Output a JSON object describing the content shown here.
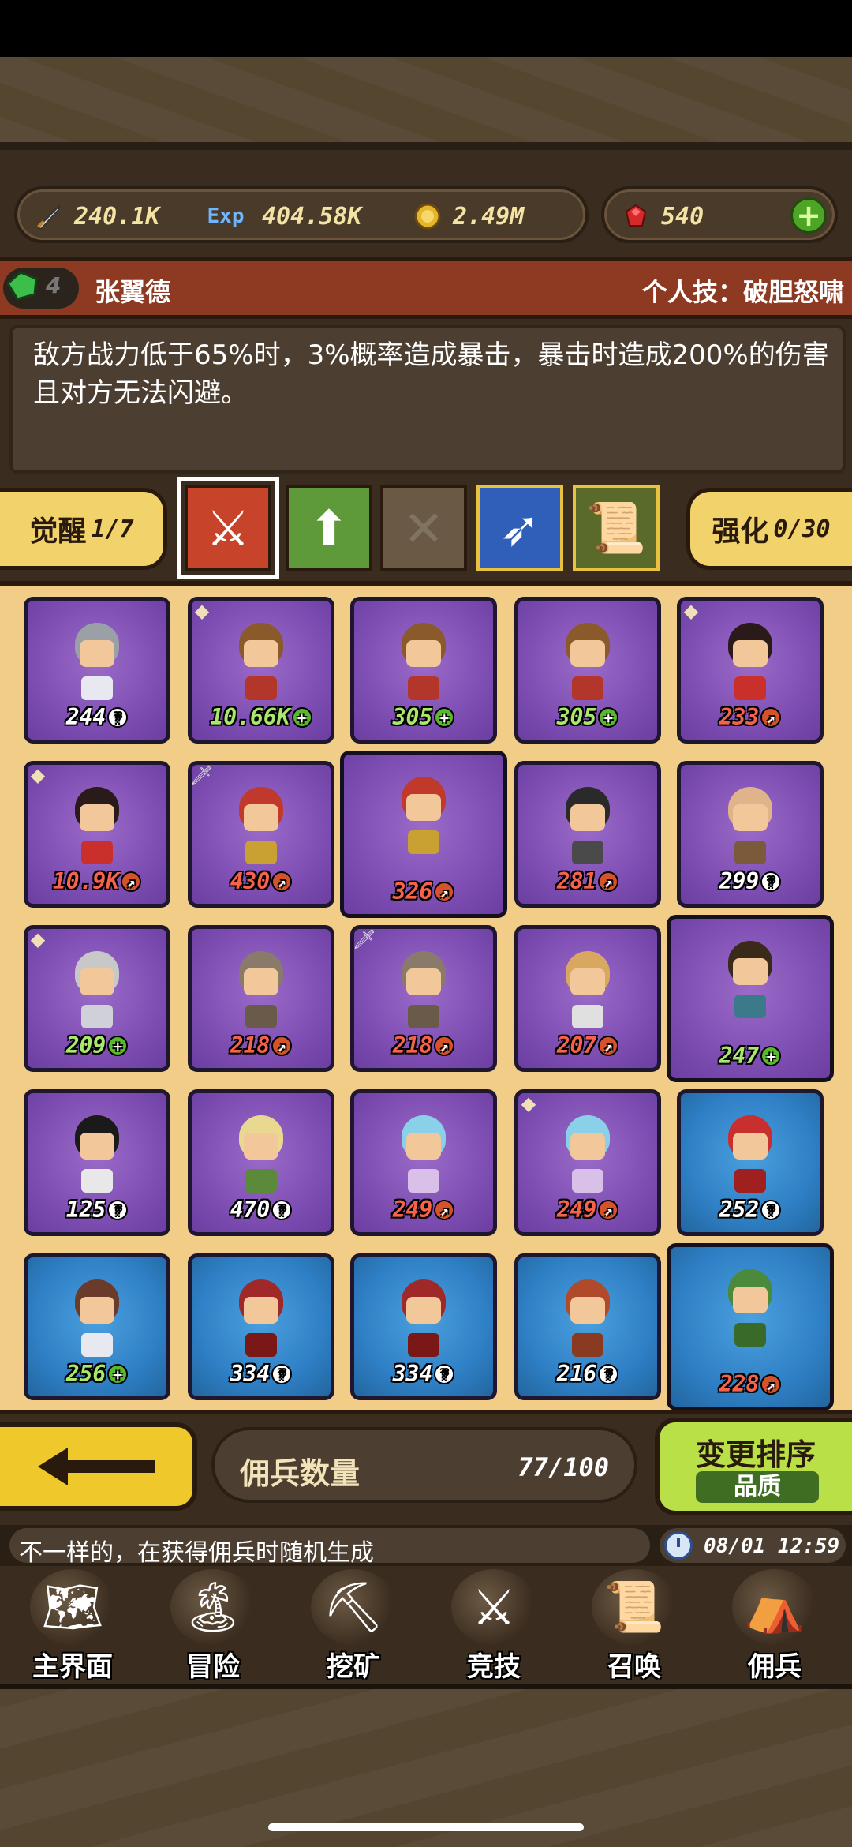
{
  "resources": {
    "attack": {
      "icon": "sword-icon",
      "value": "240.1K"
    },
    "exp": {
      "icon": "exp-icon",
      "label": "Exp",
      "value": "404.58K"
    },
    "gold": {
      "icon": "coin-icon",
      "value": "2.49M"
    },
    "gem": {
      "icon": "ruby-icon",
      "value": "540"
    },
    "add": "+"
  },
  "hero": {
    "gem_level": "4",
    "name": "张翼德",
    "skill": "个人技：破胆怒啸",
    "description": "敌方战力低于65%时，3%概率造成暴击，暴击时造成200%的伤害且对方无法闪避。"
  },
  "tabs": {
    "awaken_label": "觉醒",
    "awaken_value": "1/7",
    "enhance_label": "强化",
    "enhance_value": "0/30"
  },
  "skills": [
    {
      "icon": "crossed-blades-icon",
      "glyph": "⚔"
    },
    {
      "icon": "up-deal-icon",
      "glyph": "⬆"
    },
    {
      "icon": "empty-slot-icon",
      "glyph": "✕"
    },
    {
      "icon": "spear-icon",
      "glyph": "➶"
    },
    {
      "icon": "scroll-icon",
      "glyph": "📜"
    }
  ],
  "mercenaries": [
    {
      "level": "244",
      "badge": "?",
      "color": "white",
      "bg": "purple",
      "tag": "",
      "hair": "#9aa0a6",
      "cloth": "#e8e8f0"
    },
    {
      "level": "10.66K",
      "badge": "+",
      "color": "green",
      "bg": "purple",
      "tag": "leaf",
      "hair": "#8a5a2b",
      "cloth": "#b3362b"
    },
    {
      "level": "305",
      "badge": "+",
      "color": "green",
      "bg": "purple",
      "tag": "",
      "hair": "#8a5a2b",
      "cloth": "#b3362b"
    },
    {
      "level": "305",
      "badge": "+",
      "color": "green",
      "bg": "purple",
      "tag": "",
      "hair": "#8a5a2b",
      "cloth": "#b3362b"
    },
    {
      "level": "233",
      "badge": "↗",
      "color": "red",
      "bg": "purple",
      "tag": "leaf",
      "hair": "#2a1a1a",
      "cloth": "#c9302c"
    },
    {
      "level": "10.9K",
      "badge": "↗",
      "color": "red",
      "bg": "purple",
      "tag": "leaf",
      "hair": "#2a1a1a",
      "cloth": "#c9302c"
    },
    {
      "level": "430",
      "badge": "↗",
      "color": "red",
      "bg": "purple",
      "tag": "sword",
      "hair": "#c0392b",
      "cloth": "#c9a032"
    },
    {
      "level": "326",
      "badge": "↗",
      "color": "red",
      "bg": "purple",
      "tag": "",
      "hair": "#c0392b",
      "cloth": "#c9a032",
      "big": true
    },
    {
      "level": "281",
      "badge": "↗",
      "color": "red",
      "bg": "purple",
      "tag": "",
      "hair": "#2a2a2a",
      "cloth": "#4a4a4a"
    },
    {
      "level": "299",
      "badge": "?",
      "color": "white",
      "bg": "purple",
      "tag": "",
      "hair": "#e0b48a",
      "cloth": "#7a5a3a"
    },
    {
      "level": "209",
      "badge": "+",
      "color": "green",
      "bg": "purple",
      "tag": "leaf",
      "hair": "#c8c8c8",
      "cloth": "#d0d0d8"
    },
    {
      "level": "218",
      "badge": "↗",
      "color": "red",
      "bg": "purple",
      "tag": "",
      "hair": "#8a7a6a",
      "cloth": "#6a5a4a"
    },
    {
      "level": "218",
      "badge": "↗",
      "color": "red",
      "bg": "purple",
      "tag": "sword",
      "hair": "#8a7a6a",
      "cloth": "#6a5a4a"
    },
    {
      "level": "207",
      "badge": "↗",
      "color": "red",
      "bg": "purple",
      "tag": "",
      "hair": "#d8a860",
      "cloth": "#e0e0e0"
    },
    {
      "level": "247",
      "badge": "+",
      "color": "green",
      "bg": "purple",
      "tag": "",
      "hair": "#3a2a1a",
      "cloth": "#3a7a8a",
      "big": true
    },
    {
      "level": "125",
      "badge": "?",
      "color": "white",
      "bg": "purple",
      "tag": "",
      "hair": "#1a1a1a",
      "cloth": "#e8e8e8"
    },
    {
      "level": "470",
      "badge": "?",
      "color": "white",
      "bg": "purple",
      "tag": "",
      "hair": "#e8d890",
      "cloth": "#5a8a3a"
    },
    {
      "level": "249",
      "badge": "↗",
      "color": "red",
      "bg": "purple",
      "tag": "",
      "hair": "#8ad0e8",
      "cloth": "#d8c0e8"
    },
    {
      "level": "249",
      "badge": "↗",
      "color": "red",
      "bg": "purple",
      "tag": "leaf",
      "hair": "#8ad0e8",
      "cloth": "#d8c0e8"
    },
    {
      "level": "252",
      "badge": "?",
      "color": "white",
      "bg": "blue",
      "tag": "",
      "hair": "#c83030",
      "cloth": "#a02020"
    },
    {
      "level": "256",
      "badge": "+",
      "color": "green",
      "bg": "blue",
      "tag": "",
      "hair": "#6a3a2a",
      "cloth": "#e8e8f0"
    },
    {
      "level": "334",
      "badge": "?",
      "color": "white",
      "bg": "blue",
      "tag": "",
      "hair": "#a02828",
      "cloth": "#7a1818"
    },
    {
      "level": "334",
      "badge": "?",
      "color": "white",
      "bg": "blue",
      "tag": "",
      "hair": "#a02828",
      "cloth": "#7a1818"
    },
    {
      "level": "216",
      "badge": "?",
      "color": "white",
      "bg": "blue",
      "tag": "",
      "hair": "#b04a2a",
      "cloth": "#8a3a20"
    },
    {
      "level": "228",
      "badge": "↗",
      "color": "red",
      "bg": "blue",
      "tag": "",
      "hair": "#4a8a3a",
      "cloth": "#3a6a2a",
      "big": true
    }
  ],
  "bottom": {
    "back_icon": "left-arrow-icon",
    "count_label": "佣兵数量",
    "count_value": "77/100",
    "sort_label": "变更排序",
    "sort_mode": "品质"
  },
  "ticker": {
    "text": "不一样的，在获得佣兵时随机生成",
    "time": "08/01 12:59"
  },
  "nav": [
    {
      "label": "主界面",
      "icon": "map-scroll-icon",
      "glyph": "🗺"
    },
    {
      "label": "冒险",
      "icon": "island-icon",
      "glyph": "🏝"
    },
    {
      "label": "挖矿",
      "icon": "pickaxe-icon",
      "glyph": "⛏"
    },
    {
      "label": "竞技",
      "icon": "crossed-swords-icon",
      "glyph": "⚔"
    },
    {
      "label": "召唤",
      "icon": "summon-scroll-icon",
      "glyph": "📜"
    },
    {
      "label": "佣兵",
      "icon": "tent-icon",
      "glyph": "⛺"
    }
  ]
}
